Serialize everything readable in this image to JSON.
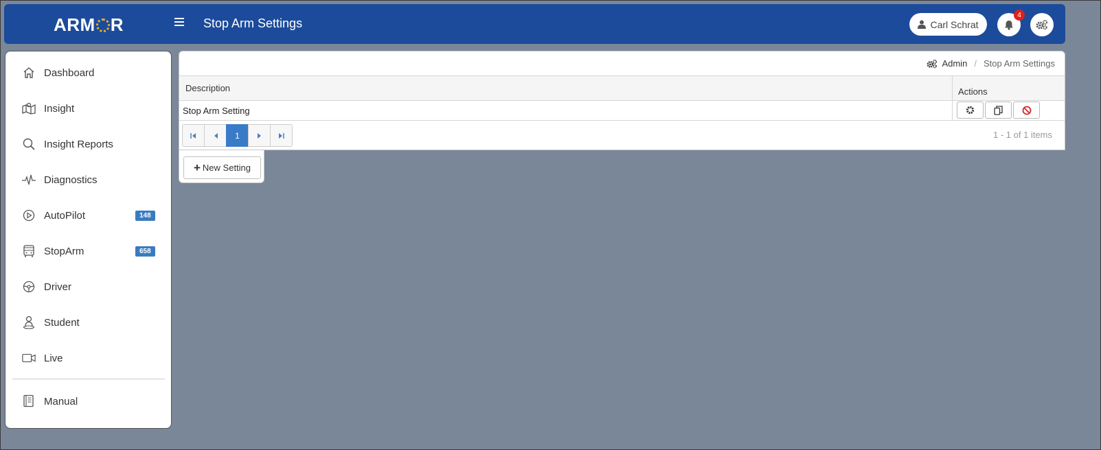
{
  "header": {
    "logo_prefix": "ARM",
    "logo_suffix": "R",
    "page_title": "Stop Arm Settings",
    "user_name": "Carl Schrat",
    "notification_count": "4"
  },
  "sidebar": {
    "items": [
      {
        "label": "Dashboard",
        "icon": "home-icon"
      },
      {
        "label": "Insight",
        "icon": "map-icon"
      },
      {
        "label": "Insight Reports",
        "icon": "search-icon"
      },
      {
        "label": "Diagnostics",
        "icon": "pulse-icon"
      },
      {
        "label": "AutoPilot",
        "icon": "play-circle-icon",
        "count": "148"
      },
      {
        "label": "StopArm",
        "icon": "bus-icon",
        "count": "658"
      },
      {
        "label": "Driver",
        "icon": "steering-wheel-icon"
      },
      {
        "label": "Student",
        "icon": "student-icon"
      },
      {
        "label": "Live",
        "icon": "video-camera-icon"
      },
      {
        "label": "Manual",
        "icon": "book-icon"
      }
    ]
  },
  "breadcrumb": {
    "parent": "Admin",
    "current": "Stop Arm Settings"
  },
  "grid": {
    "columns": {
      "description": "Description",
      "actions": "Actions"
    },
    "rows": [
      {
        "description": "Stop Arm Setting"
      }
    ]
  },
  "pager": {
    "current_page": "1",
    "info": "1 - 1 of 1 items"
  },
  "actions": {
    "new_label": "New Setting"
  },
  "colors": {
    "header_bg": "#1c4b9b",
    "page_bg": "#7a8799",
    "badge_blue": "#3a7bbf",
    "notif_red": "#e0201a",
    "delete_red": "#d9262b"
  }
}
